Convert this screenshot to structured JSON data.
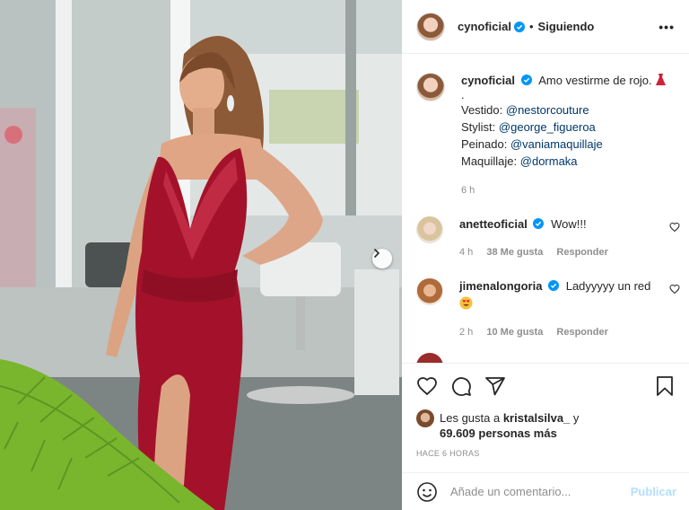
{
  "post": {
    "author": "cynoficial",
    "follow_status": "Siguiendo",
    "more_label": "•••",
    "separator": "•"
  },
  "caption": {
    "username": "cynoficial",
    "text": "Amo vestirme de rojo.",
    "dot_line": ".",
    "credits": [
      {
        "label": "Vestido: ",
        "handle": "@nestorcouture"
      },
      {
        "label": "Stylist: ",
        "handle": "@george_figueroa"
      },
      {
        "label": "Peinado: ",
        "handle": "@vaniamaquillaje"
      },
      {
        "label": "Maquillaje: ",
        "handle": "@dormaka"
      }
    ],
    "time": "6 h"
  },
  "comments": [
    {
      "username": "anetteoficial",
      "text": "Wow!!!",
      "time": "4 h",
      "likes": "38 Me gusta",
      "reply": "Responder"
    },
    {
      "username": "jimenalongoria",
      "text": "Ladyyyyy un red",
      "time": "2 h",
      "likes": "10 Me gusta",
      "reply": "Responder"
    }
  ],
  "likes": {
    "prefix": "Les gusta a ",
    "user": "kristalsilva_",
    "mid": " y",
    "count": "69.609 personas más"
  },
  "posted_ago": "HACE 6 HORAS",
  "add_comment": {
    "placeholder": "Añade un comentario...",
    "publish_label": "Publicar"
  },
  "colors": {
    "verified_blue": "#0095f6",
    "link": "#00376b",
    "muted": "#8e8e8e",
    "publish_disabled": "#b2dffc",
    "dress_red": "#a3122a"
  },
  "icons": [
    "verified-icon",
    "heart-icon",
    "comment-icon",
    "share-icon",
    "bookmark-icon",
    "emoji-icon",
    "chevron-right-icon",
    "red-dress-emoji-icon",
    "heart-eyes-emoji-icon"
  ]
}
